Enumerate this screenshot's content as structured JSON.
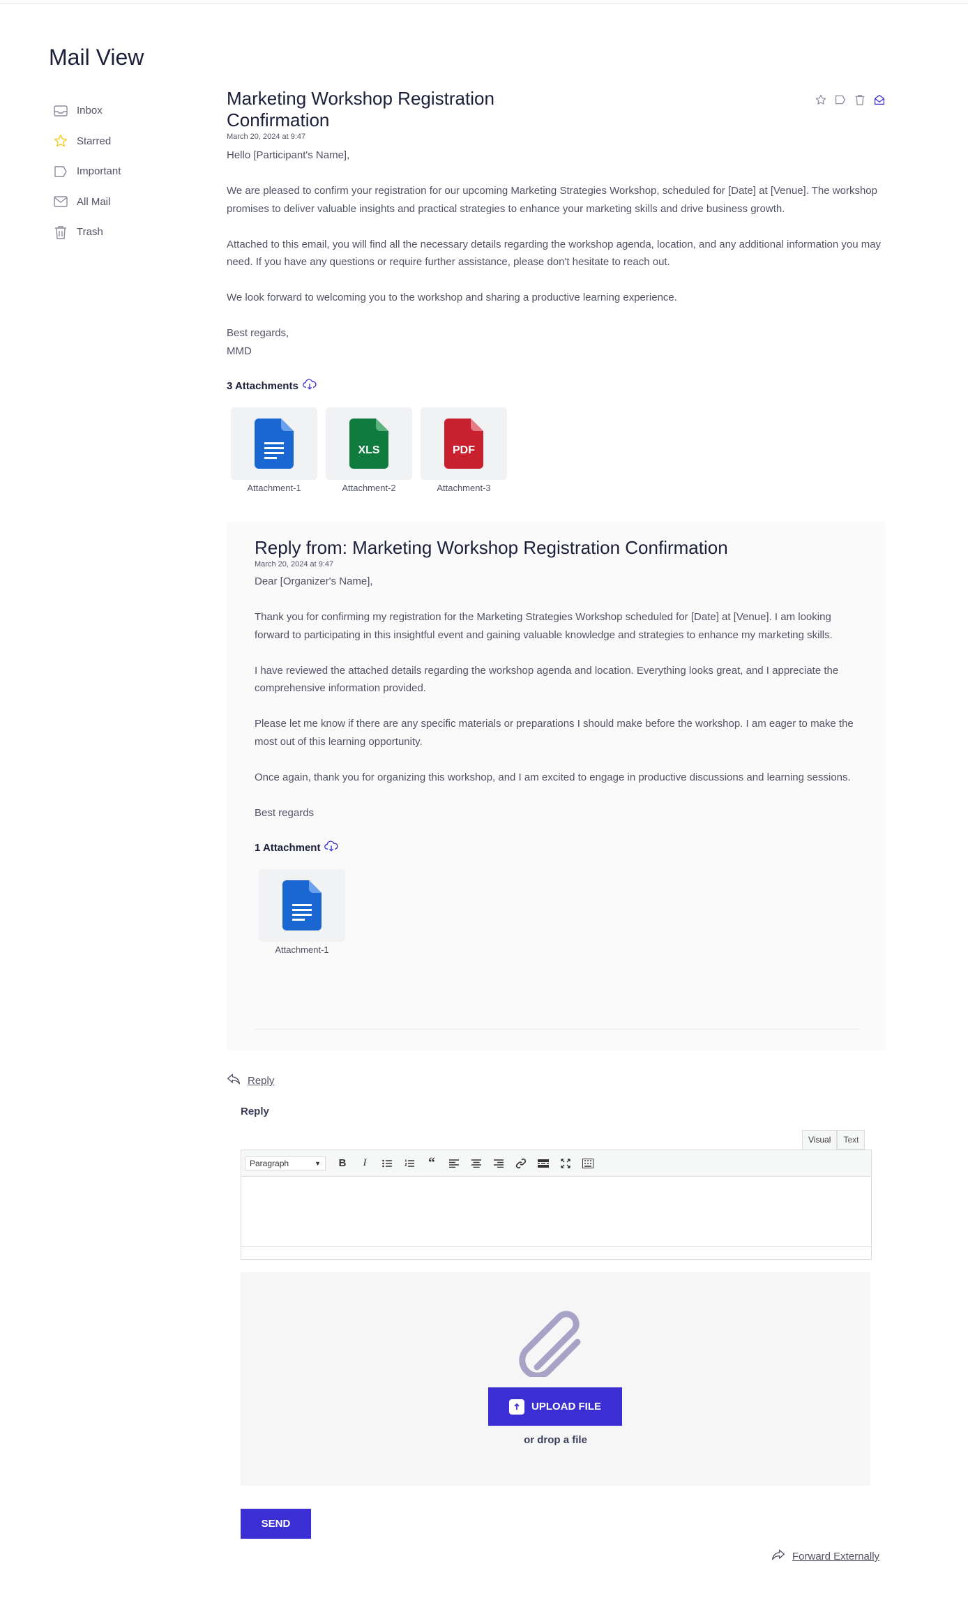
{
  "page": {
    "title": "Mail View"
  },
  "sidebar": {
    "items": [
      {
        "label": "Inbox",
        "icon": "inbox-icon"
      },
      {
        "label": "Starred",
        "icon": "star-icon"
      },
      {
        "label": "Important",
        "icon": "bookmark-icon"
      },
      {
        "label": "All Mail",
        "icon": "mail-icon"
      },
      {
        "label": "Trash",
        "icon": "trash-icon"
      }
    ]
  },
  "mail": {
    "subject": "Marketing Workshop Registration Confirmation",
    "date": "March 20, 2024 at 9:47",
    "greeting": "Hello [Participant's Name],",
    "paragraphs": [
      "We are pleased to confirm your registration for our upcoming Marketing Strategies Workshop, scheduled for [Date] at [Venue]. The workshop promises to deliver valuable insights and practical strategies to enhance your marketing skills and drive business growth.",
      "Attached to this email, you will find all the necessary details regarding the workshop agenda, location, and any additional information you may need. If you have any questions or require further assistance, please don't hesitate to reach out.",
      "We look forward to welcoming you to the workshop and sharing a productive learning experience."
    ],
    "closing": "Best regards,",
    "signature": "MMD",
    "attachments_title": "3 Attachments",
    "attachments": [
      {
        "name": "Attachment-1",
        "type": "doc"
      },
      {
        "name": "Attachment-2",
        "type": "xls",
        "badge": "XLS"
      },
      {
        "name": "Attachment-3",
        "type": "pdf",
        "badge": "PDF"
      }
    ]
  },
  "reply_mail": {
    "subject": "Reply from: Marketing Workshop Registration Confirmation",
    "date": "March 20, 2024 at 9:47",
    "greeting": "Dear [Organizer's Name],",
    "paragraphs": [
      "Thank you for confirming my registration for the Marketing Strategies Workshop scheduled for [Date] at [Venue]. I am looking forward to participating in this insightful event and gaining valuable knowledge and strategies to enhance my marketing skills.",
      "I have reviewed the attached details regarding the workshop agenda and location. Everything looks great, and I appreciate the comprehensive information provided.",
      "Please let me know if there are any specific materials or preparations I should make before the workshop. I am eager to make the most out of this learning opportunity.",
      "Once again, thank you for organizing this workshop, and I am excited to engage in productive discussions and learning sessions."
    ],
    "closing": "Best regards",
    "attachments_title": "1 Attachment",
    "attachments": [
      {
        "name": "Attachment-1",
        "type": "doc"
      }
    ]
  },
  "reply": {
    "link_label": "Reply",
    "section_label": "Reply",
    "tabs": {
      "visual": "Visual",
      "text": "Text"
    },
    "format_select": "Paragraph",
    "upload_label": "UPLOAD FILE",
    "drop_label": "or drop a file",
    "send_label": "SEND"
  },
  "forward": {
    "label": "Forward Externally"
  },
  "colors": {
    "accent": "#3b2fd4",
    "doc": "#1a67d2",
    "xls": "#0f7b3e",
    "pdf": "#c8202f",
    "star": "#f5c518"
  }
}
